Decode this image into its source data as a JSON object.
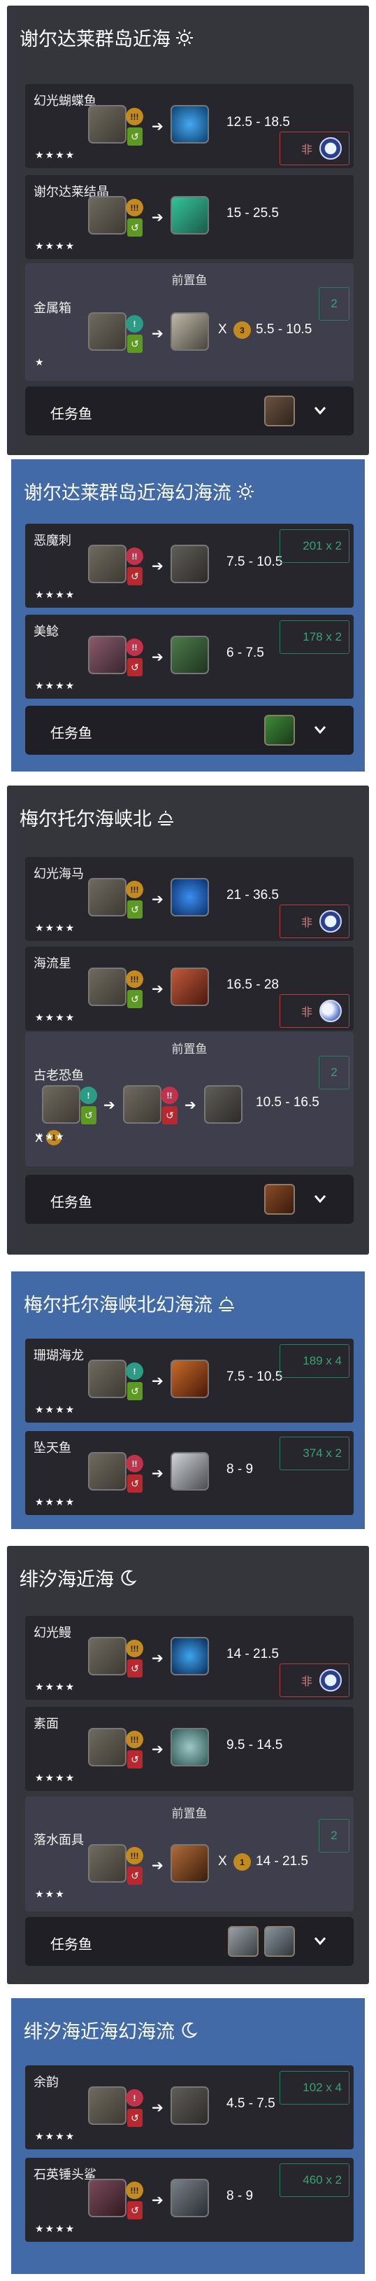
{
  "ui": {
    "icons": [
      "sun-icon",
      "moon-icon",
      "lock-icon",
      "chevron-down-icon",
      "fish-icon",
      "lure-icon"
    ]
  },
  "sections": [
    {
      "title": "谢尔达莱群岛近海",
      "weather_icon": "sun-icon",
      "fish": [
        {
          "name": "幻光蝴蝶鱼",
          "stars": "★★★★",
          "hook": "!!!",
          "tug": "↺",
          "value": "12.5 - 18.5",
          "cond_label": "非"
        },
        {
          "name": "谢尔达莱结晶",
          "stars": "★★★★",
          "hook": "!!!",
          "tug": "↺",
          "value": "15 - 25.5"
        }
      ],
      "prefish": {
        "header": "前置鱼",
        "fish": {
          "name": "金属箱",
          "stars": "★",
          "hook": "!",
          "tug": "↺",
          "mult": "X",
          "mult_count": "3",
          "value": "5.5 - 10.5",
          "count": "2"
        }
      },
      "task": {
        "label": "任务鱼"
      }
    },
    {
      "title": "谢尔达莱群岛近海幻海流",
      "weather_icon": "sun-icon",
      "fish": [
        {
          "name": "恶魔刺",
          "stars": "★★★★",
          "hook": "!!",
          "tug": "↺",
          "value": "7.5 - 10.5",
          "count": "201 x 2"
        },
        {
          "name": "美鲶",
          "stars": "★★★★",
          "hook": "!!",
          "tug": "↺",
          "value": "6 - 7.5",
          "count": "178 x 2"
        }
      ],
      "task": {
        "label": "任务鱼"
      }
    },
    {
      "title": "梅尔托尔海峡北",
      "weather_icon": "cloud-sun-icon",
      "fish": [
        {
          "name": "幻光海马",
          "stars": "★★★★",
          "hook": "!!!",
          "tug": "↺",
          "value": "21 - 36.5",
          "cond_label": "非"
        },
        {
          "name": "海流星",
          "stars": "★★★★",
          "hook": "!!!",
          "tug": "↺",
          "value": "16.5 - 28",
          "cond_label": "非"
        }
      ],
      "prefish": {
        "header": "前置鱼",
        "fish": {
          "name": "古老恐鱼",
          "stars": "★★★",
          "hook": "!",
          "hook2": "!!",
          "tug": "↺",
          "mult": "X",
          "mult_count": "1",
          "value": "10.5 - 16.5",
          "count": "2"
        }
      },
      "task": {
        "label": "任务鱼"
      }
    },
    {
      "title": "梅尔托尔海峡北幻海流",
      "weather_icon": "cloud-sun-icon",
      "fish": [
        {
          "name": "珊瑚海龙",
          "stars": "★★★★",
          "hook": "!",
          "tug": "↺",
          "value": "7.5 - 10.5",
          "count": "189 x 4"
        },
        {
          "name": "坠天鱼",
          "stars": "★★★★",
          "hook": "!!",
          "tug": "↺",
          "value": "8 - 9",
          "count": "374 x 2"
        }
      ]
    },
    {
      "title": "绯汐海近海",
      "weather_icon": "moon-icon",
      "fish": [
        {
          "name": "幻光鳗",
          "stars": "★★★★",
          "hook": "!!!",
          "tug": "↺",
          "value": "14 - 21.5",
          "cond_label": "非"
        },
        {
          "name": "素面",
          "stars": "★★★★",
          "hook": "!!!",
          "tug": "↺",
          "value": "9.5 - 14.5"
        }
      ],
      "prefish": {
        "header": "前置鱼",
        "fish": {
          "name": "落水面具",
          "stars": "★★★",
          "hook": "!!!",
          "tug": "↺",
          "mult": "X",
          "mult_count": "1",
          "value": "14 - 21.5",
          "count": "2"
        }
      },
      "task": {
        "label": "任务鱼"
      }
    },
    {
      "title": "绯汐海近海幻海流",
      "weather_icon": "moon-icon",
      "fish": [
        {
          "name": "余韵",
          "stars": "★★★★",
          "hook": "!",
          "tug": "↺",
          "value": "4.5 - 7.5",
          "count": "102 x 4"
        },
        {
          "name": "石英锤头鲨",
          "stars": "★★★★",
          "hook": "!!!",
          "tug": "↺",
          "value": "8 - 9",
          "count": "460 x 2"
        }
      ]
    }
  ]
}
